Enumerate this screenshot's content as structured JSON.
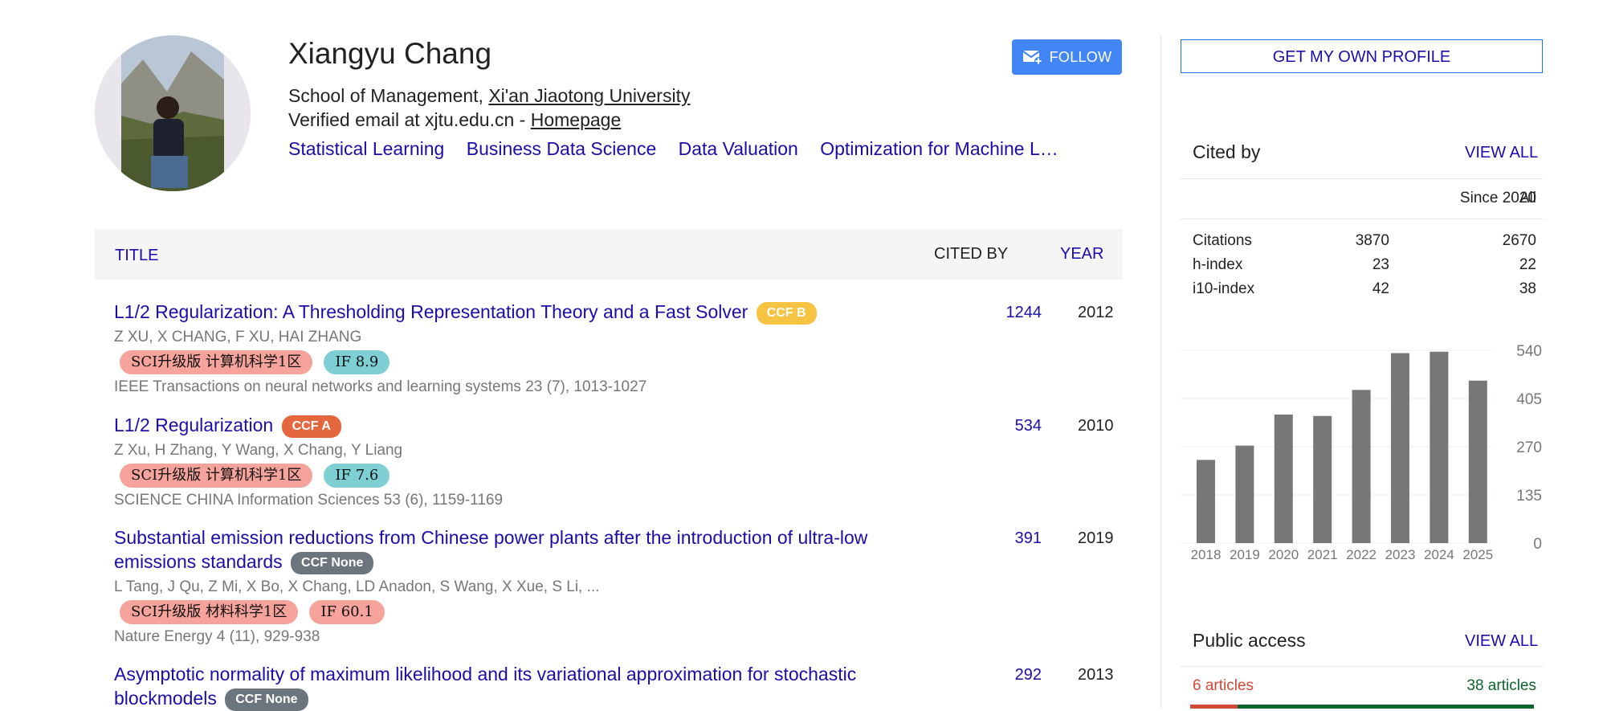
{
  "profile": {
    "name": "Xiangyu Chang",
    "affiliation_prefix": "School of Management, ",
    "affiliation_link": "Xi'an Jiaotong University",
    "email_prefix": "Verified email at xjtu.edu.cn - ",
    "homepage": "Homepage",
    "interests": [
      "Statistical Learning",
      "Business Data Science",
      "Data Valuation",
      "Optimization for Machine L…"
    ],
    "follow_label": "FOLLOW"
  },
  "table": {
    "col_title": "TITLE",
    "col_cited": "CITED BY",
    "col_year": "YEAR"
  },
  "articles": [
    {
      "title": "L1/2 Regularization: A Thresholding Representation Theory and a Fast Solver",
      "ccf": "CCF B",
      "authors": "Z XU, X CHANG, F XU, HAI ZHANG",
      "sci": "SCI升级版 计算机科学1区",
      "if": "IF 8.9",
      "venue": "IEEE Transactions on neural networks and learning systems 23 (7), 1013-1027",
      "cited": "1244",
      "year": "2012"
    },
    {
      "title": "L1/2 Regularization",
      "ccf": "CCF A",
      "authors": "Z Xu, H Zhang, Y Wang, X Chang, Y Liang",
      "sci": "SCI升级版 计算机科学1区",
      "if": "IF 7.6",
      "venue": "SCIENCE CHINA Information Sciences 53 (6), 1159-1169",
      "cited": "534",
      "year": "2010"
    },
    {
      "title_line1": "Substantial emission reductions from Chinese power plants after the introduction of ultra-low",
      "title_line2": "emissions standards",
      "ccf": "CCF None",
      "authors": "L Tang, J Qu, Z Mi, X Bo, X Chang, LD Anadon, S Wang, X Xue, S Li, ...",
      "sci": "SCI升级版 材料科学1区",
      "if": "IF 60.1",
      "venue": "Nature Energy 4 (11), 929-938",
      "cited": "391",
      "year": "2019"
    },
    {
      "title_line1": "Asymptotic normality of maximum likelihood and its variational approximation for stochastic",
      "title_line2": "blockmodels",
      "ccf": "CCF None",
      "cited": "292",
      "year": "2013"
    }
  ],
  "sidebar": {
    "get_profile": "GET MY OWN PROFILE",
    "cited_by_title": "Cited by",
    "view_all": "VIEW ALL",
    "col_all": "All",
    "col_since": "Since 2020",
    "stats": [
      {
        "label": "Citations",
        "all": "3870",
        "since": "2670"
      },
      {
        "label": "h-index",
        "all": "23",
        "since": "22"
      },
      {
        "label": "i10-index",
        "all": "42",
        "since": "38"
      }
    ],
    "public_access_title": "Public access",
    "public_view_all": "VIEW ALL",
    "not_available": "6 articles",
    "available": "38 articles"
  },
  "colors": {
    "link": "#1a0dab",
    "follow_bg": "#4285f4",
    "ccf_b": "#f6c343",
    "ccf_a": "#e5673d",
    "ccf_none": "#6c757d",
    "bar": "#777777",
    "not_available": "#d14836",
    "available": "#0d652d"
  },
  "chart_data": {
    "type": "bar",
    "categories": [
      "2018",
      "2019",
      "2020",
      "2021",
      "2022",
      "2023",
      "2024",
      "2025"
    ],
    "values": [
      233,
      273,
      360,
      356,
      429,
      532,
      536,
      455
    ],
    "yticks": [
      0,
      135,
      270,
      405,
      540
    ],
    "ylim": [
      0,
      540
    ]
  }
}
